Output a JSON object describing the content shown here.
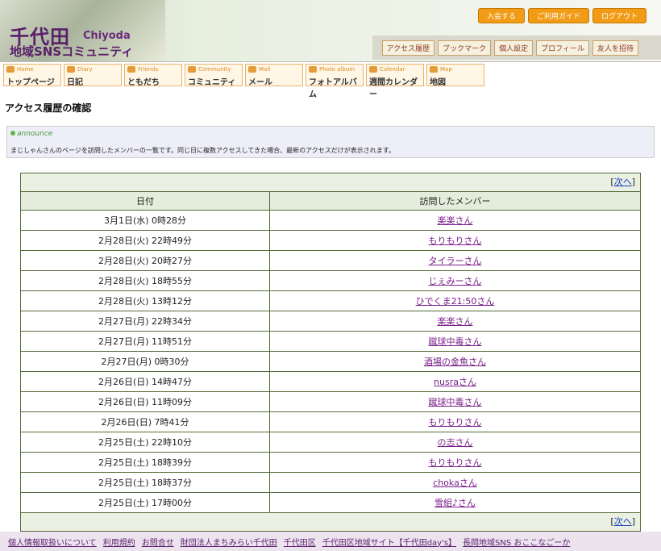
{
  "brand": {
    "kanji": "千代田",
    "roman": "Chiyoda",
    "subtitle": "地域SNSコミュニティ"
  },
  "top_links": [
    "入会する",
    "ご利用ガイド",
    "ログアウト"
  ],
  "sub_links": [
    "アクセス履歴",
    "ブックマーク",
    "個人設定",
    "プロフィール",
    "友人を招待"
  ],
  "nav": [
    {
      "en": "Home",
      "jp": "トップページ"
    },
    {
      "en": "Diary",
      "jp": "日記"
    },
    {
      "en": "Friends",
      "jp": "ともだち"
    },
    {
      "en": "Community",
      "jp": "コミュニティ"
    },
    {
      "en": "Mail",
      "jp": "メール"
    },
    {
      "en": "Photo album",
      "jp": "フォトアルバム"
    },
    {
      "en": "Calendar",
      "jp": "週間カレンダー"
    },
    {
      "en": "Map",
      "jp": "地図"
    }
  ],
  "page_title": "アクセス履歴の確認",
  "announce": {
    "tag": "announce",
    "message": "まじしゃんさんのページを訪問したメンバーの一覧です。同じ日に複数アクセスしてきた場合、最新のアクセスだけが表示されます。"
  },
  "pager": {
    "next_label": "次へ",
    "open": "[",
    "close": "]"
  },
  "table": {
    "headers": [
      "日付",
      "訪問したメンバー"
    ],
    "rows": [
      {
        "date": "3月1日(水) 0時28分",
        "member": "楽楽さん"
      },
      {
        "date": "2月28日(火) 22時49分",
        "member": "もりもりさん"
      },
      {
        "date": "2月28日(火) 20時27分",
        "member": "タイラーさん"
      },
      {
        "date": "2月28日(火) 18時55分",
        "member": "じぇみーさん"
      },
      {
        "date": "2月28日(火) 13時12分",
        "member": "ひでくま21:50さん"
      },
      {
        "date": "2月27日(月) 22時34分",
        "member": "楽楽さん"
      },
      {
        "date": "2月27日(月) 11時51分",
        "member": "蹴球中毒さん"
      },
      {
        "date": "2月27日(月) 0時30分",
        "member": "酒場の金魚さん"
      },
      {
        "date": "2月26日(日) 14時47分",
        "member": "nusraさん"
      },
      {
        "date": "2月26日(日) 11時09分",
        "member": "蹴球中毒さん"
      },
      {
        "date": "2月26日(日) 7時41分",
        "member": "もりもりさん"
      },
      {
        "date": "2月25日(土) 22時10分",
        "member": "の志さん"
      },
      {
        "date": "2月25日(土) 18時39分",
        "member": "もりもりさん"
      },
      {
        "date": "2月25日(土) 18時37分",
        "member": "chokaさん"
      },
      {
        "date": "2月25日(土) 17時00分",
        "member": "雪組♪さん"
      }
    ]
  },
  "footer_links": [
    "個人情報取扱いについて",
    "利用規約",
    "お問合せ",
    "財団法人まちみらい千代田",
    "千代田区",
    "千代田区地域サイト【千代田day's】",
    "長岡地域SNS おここなごーか"
  ]
}
